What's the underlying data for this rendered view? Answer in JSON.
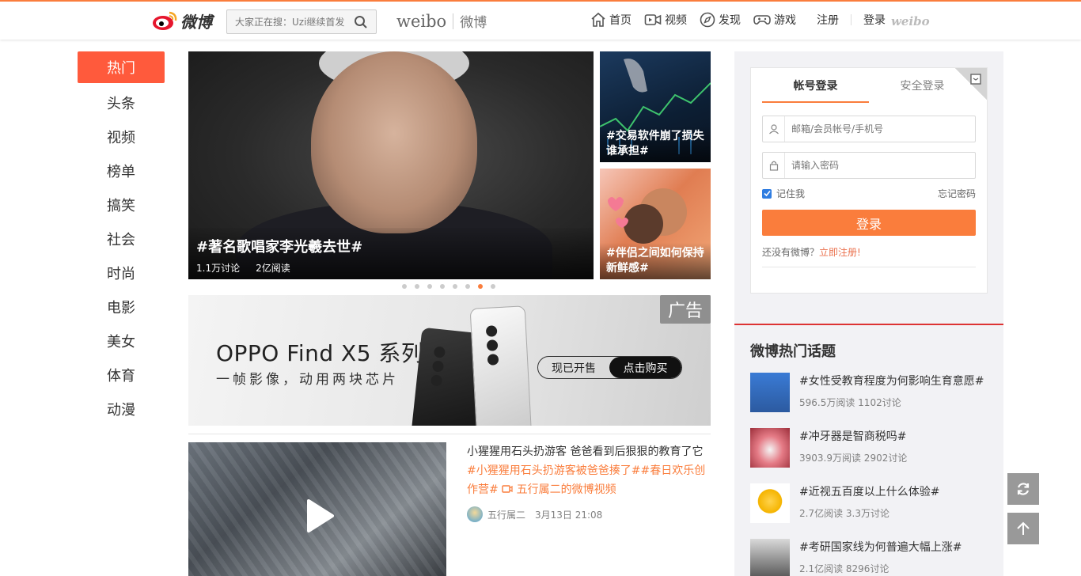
{
  "header": {
    "logo_text": "微博",
    "search_placeholder": "大家正在搜：Uzi继续首发",
    "brand_en": "weibo",
    "brand_cn": "微博",
    "nav": [
      {
        "label": "首页",
        "icon": "home-icon"
      },
      {
        "label": "视频",
        "icon": "video-icon"
      },
      {
        "label": "发现",
        "icon": "compass-icon"
      },
      {
        "label": "游戏",
        "icon": "gamepad-icon"
      }
    ],
    "register": "注册",
    "login": "登录",
    "weibo_small": "weibo"
  },
  "leftnav": [
    "热门",
    "头条",
    "视频",
    "榜单",
    "搞笑",
    "社会",
    "时尚",
    "电影",
    "美女",
    "体育",
    "动漫"
  ],
  "hero": {
    "title": "#著名歌唱家李光羲去世#",
    "discussions": "1.1万讨论",
    "reads": "2亿阅读"
  },
  "side_cards": [
    {
      "caption": "#交易软件崩了损失谁承担#"
    },
    {
      "caption": "#伴侣之间如何保持新鲜感#"
    }
  ],
  "carousel": {
    "dot_count": 8,
    "active_dot": 6
  },
  "ad": {
    "badge": "广告",
    "title": "OPPO Find X5 系列",
    "subtitle": "一帧影像，动用两块芯片",
    "btn_sale": "现已开售",
    "btn_buy": "点击购买"
  },
  "feed": {
    "text": "小猩猩用石头扔游客 爸爸看到后狠狠的教育了它",
    "tags": "#小猩猩用石头扔游客被爸爸揍了##春日欢乐创作营# ",
    "video_link": "五行属二的微博视频",
    "author": "五行属二",
    "time": "3月13日 21:08"
  },
  "login": {
    "tab_account": "帐号登录",
    "tab_secure": "安全登录",
    "user_placeholder": "邮箱/会员帐号/手机号",
    "pass_placeholder": "请输入密码",
    "remember": "记住我",
    "forgot": "忘记密码",
    "button": "登录",
    "no_account": "还没有微博？",
    "register_now": "立即注册!"
  },
  "hot_topics": {
    "title": "微博热门话题",
    "items": [
      {
        "title": "#女性受教育程度为何影响生育意愿#",
        "stats": "596.5万阅读 1102讨论"
      },
      {
        "title": "#冲牙器是智商税吗#",
        "stats": "3903.9万阅读 2902讨论"
      },
      {
        "title": "#近视五百度以上什么体验#",
        "stats": "2.7亿阅读 3.3万讨论"
      },
      {
        "title": "#考研国家线为何普遍大幅上涨#",
        "stats": "2.1亿阅读 8296讨论"
      }
    ]
  },
  "colors": {
    "accent": "#fa7d3c",
    "active_nav": "#ff5a3c",
    "hot_red": "#d33333"
  }
}
